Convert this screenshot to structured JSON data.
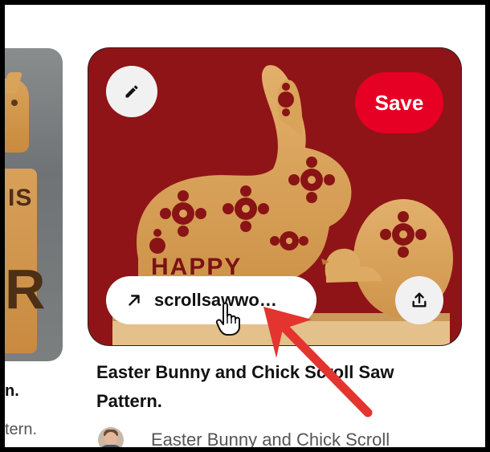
{
  "left_card": {
    "image_text_1": "IS",
    "image_text_2": "R",
    "title_fragment": "n.",
    "subtitle_fragment": "tern."
  },
  "pin": {
    "save_label": "Save",
    "link_text": "scrollsawwo…",
    "image_text": "HAPPY",
    "title": "Easter Bunny and Chick Scroll Saw Pattern.",
    "author_text": "Easter Bunny and Chick Scroll"
  },
  "icons": {
    "edit": "pencil-icon",
    "link": "arrow-up-right-icon",
    "share": "share-upload-icon",
    "cursor": "hand-pointer-cursor",
    "annotation": "red-arrow"
  },
  "colors": {
    "save_red": "#e60023",
    "card_background": "#8a1316",
    "wood": "#d9a35a",
    "annotation_red": "#e3342f"
  }
}
